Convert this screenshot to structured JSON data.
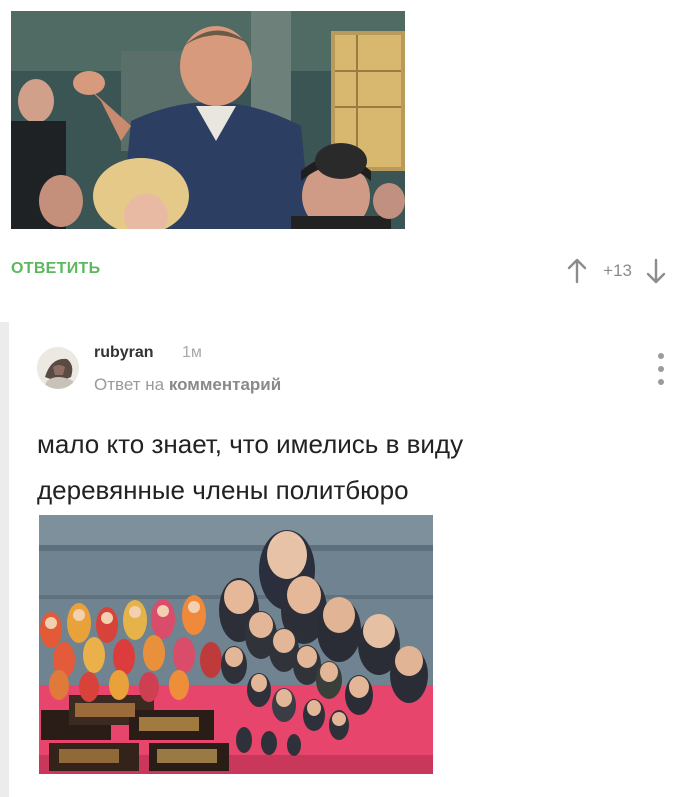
{
  "top_comment": {
    "reply_label": "ОТВЕТИТЬ",
    "rating": "+13",
    "image_icon": "movie-still-image"
  },
  "nested_comment": {
    "username": "rubyran",
    "time": "1м",
    "reply_prefix": "Ответ на",
    "reply_target": "комментарий",
    "text_line1": "мало кто знает, что имелись в виду",
    "text_line2": "деревянные члены политбюро",
    "image_icon": "matryoshka-dolls-image",
    "menu_icon": "vertical-dots-icon"
  },
  "colors": {
    "accent_green": "#5bb85d",
    "muted_text": "#9a9a9a",
    "thread_line": "#ececec"
  }
}
